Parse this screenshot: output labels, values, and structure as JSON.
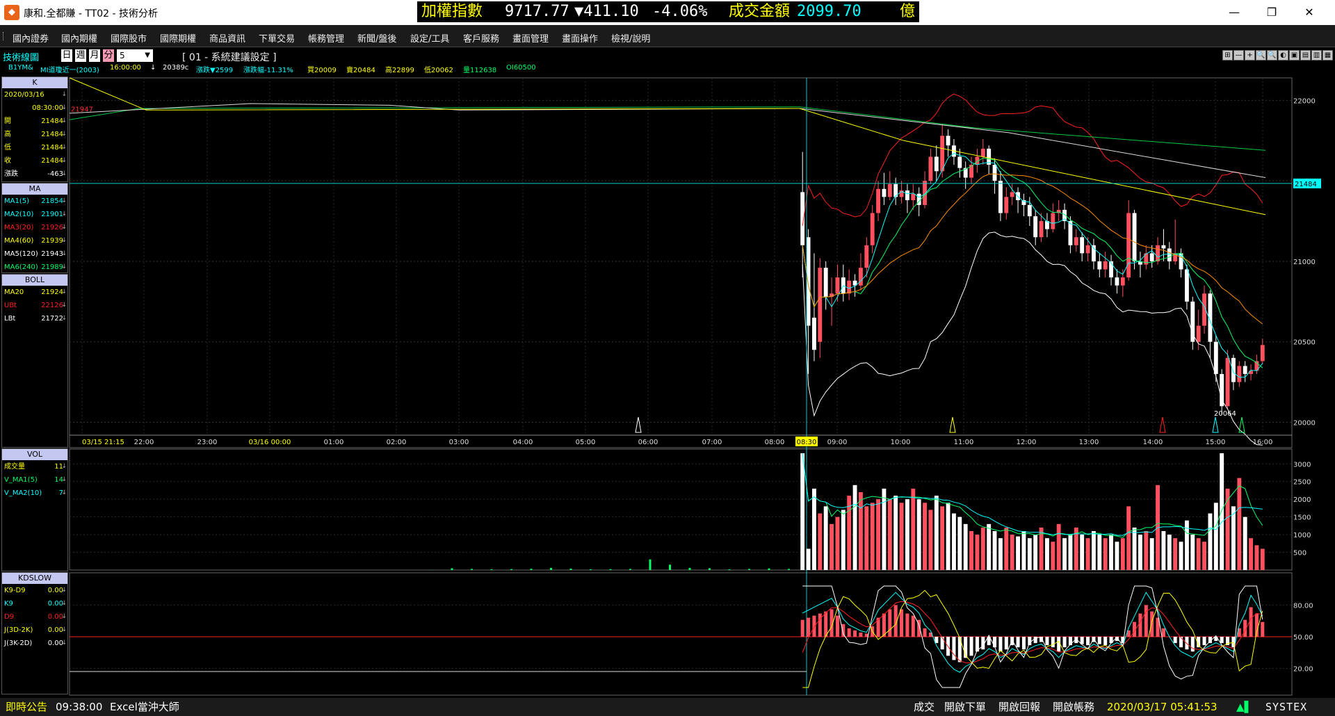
{
  "window": {
    "title": "康和.全都賺 - TT02 - 技術分析",
    "minimize_glyph": "—",
    "maximize_glyph": "❐",
    "close_glyph": "✕",
    "app_icon": "logo-icon"
  },
  "ticker": {
    "index_label": "加權指數",
    "index_value": "9717.77",
    "change": "▼411.10",
    "change_pct": "-4.06%",
    "turnover_label": "成交金額",
    "turnover_value": "2099.70",
    "unit": "億",
    "colors": {
      "label": "#ffff00",
      "value": "#ffffff",
      "down": "#ffffff",
      "accent": "#00ffff"
    }
  },
  "menu": [
    "國內證券",
    "國內期權",
    "國際股市",
    "國際期權",
    "商品資訊",
    "下單交易",
    "帳務管理",
    "新聞/盤後",
    "設定/工具",
    "客戶服務",
    "畫面管理",
    "畫面操作",
    "檢視/說明"
  ],
  "toolbar": {
    "label": "技術線圖",
    "periods": [
      "日",
      "週",
      "月",
      "分"
    ],
    "active_period": "分",
    "interval_value": "5",
    "chart_title": "[ 01 - 系統建議設定 ]",
    "buttons": [
      "⊞",
      "—",
      "+",
      "🔍",
      "🔍",
      "◐",
      "▣",
      "▤",
      "▥",
      "▦"
    ]
  },
  "info": {
    "symbol": "B1YM&",
    "name": "MI道瓊近一(2003)",
    "time": "16:00:00",
    "arrow": "↓",
    "price": "20389c",
    "change": "漲跌▼2599",
    "amplitude": "漲跌幅-11.31%",
    "bid": "買20009",
    "ask": "賣20484",
    "high": "高22899",
    "low": "低20062",
    "volume": "量112638",
    "oi": "OI60500"
  },
  "left_panels": {
    "k": {
      "header": "K",
      "rows": [
        {
          "label": "2020/03/16",
          "value": "",
          "color": "#ffff00"
        },
        {
          "label": "",
          "value": "08:30:00",
          "color": "#ffff00"
        },
        {
          "label": "開",
          "value": "21484",
          "color": "#ffff00"
        },
        {
          "label": "高",
          "value": "21484",
          "color": "#ffff00"
        },
        {
          "label": "低",
          "value": "21484",
          "color": "#ffff00"
        },
        {
          "label": "收",
          "value": "21484",
          "color": "#ffff00"
        },
        {
          "label": "漲跌",
          "value": "-463",
          "color": "#ffffff"
        }
      ]
    },
    "ma": {
      "header": "MA",
      "rows": [
        {
          "label": "MA1(5)",
          "value": "21854",
          "color": "#00ffff"
        },
        {
          "label": "MA2(10)",
          "value": "21901",
          "color": "#00ffff"
        },
        {
          "label": "MA3(20)",
          "value": "21926",
          "color": "#ff2020"
        },
        {
          "label": "MA4(60)",
          "value": "21939",
          "color": "#ffff00"
        },
        {
          "label": "MA5(120)",
          "value": "21943",
          "color": "#ffffff"
        },
        {
          "label": "MA6(240)",
          "value": "21989",
          "color": "#00ff66"
        }
      ]
    },
    "boll": {
      "header": "BOLL",
      "rows": [
        {
          "label": "MA20",
          "value": "21924",
          "color": "#ffff00"
        },
        {
          "label": "UBt",
          "value": "22126",
          "color": "#ff2020"
        },
        {
          "label": "LBt",
          "value": "21722",
          "color": "#ffffff"
        }
      ]
    },
    "vol": {
      "header": "VOL",
      "rows": [
        {
          "label": "成交量",
          "value": "11",
          "color": "#ffff00"
        },
        {
          "label": "V_MA1(5)",
          "value": "14",
          "color": "#00ff66"
        },
        {
          "label": "V_MA2(10)",
          "value": "7",
          "color": "#00ffff"
        }
      ]
    },
    "kd": {
      "header": "KDSLOW",
      "rows": [
        {
          "label": "K9-D9",
          "value": "0.00",
          "color": "#ffff00"
        },
        {
          "label": "K9",
          "value": "0.00",
          "color": "#00ffff"
        },
        {
          "label": "D9",
          "value": "0.00",
          "color": "#ff2020"
        },
        {
          "label": "J(3D-2K)",
          "value": "0.00",
          "color": "#ffff00"
        },
        {
          "label": "J(3K-2D)",
          "value": "0.00",
          "color": "#ffffff"
        }
      ]
    }
  },
  "chart_data": {
    "type": "candlestick",
    "price_axis": {
      "ticks": [
        "22000",
        "21500",
        "21000",
        "20500",
        "20000"
      ],
      "ylim": [
        19920,
        22140
      ],
      "marker": "21484",
      "low_label": "20064",
      "left_label": "21947"
    },
    "time_axis": {
      "labels": [
        "03/15 21:15",
        "22:00",
        "23:00",
        "03/16 00:00",
        "01:00",
        "02:00",
        "03:00",
        "04:00",
        "05:00",
        "06:00",
        "07:00",
        "08:00",
        "08:30",
        "09:00",
        "10:00",
        "11:00",
        "12:00",
        "13:00",
        "14:00",
        "15:00",
        "16:00"
      ],
      "highlight": "08:30"
    },
    "vol_axis": {
      "ticks": [
        "3000",
        "2500",
        "2000",
        "1500",
        "1000",
        "500"
      ],
      "ylim": [
        0,
        3300
      ]
    },
    "kd_axis": {
      "ticks": [
        "80.00",
        "50.00",
        "20.00"
      ],
      "ylim": [
        0,
        100
      ]
    },
    "candles": [
      [
        21430,
        21100,
        21680,
        20900
      ],
      [
        21150,
        20600,
        21200,
        20300
      ],
      [
        20650,
        20450,
        21050,
        20380
      ],
      [
        20500,
        20960,
        21020,
        20400
      ],
      [
        20960,
        20780,
        21000,
        20700
      ],
      [
        20780,
        20800,
        20900,
        20600
      ],
      [
        20800,
        20900,
        20980,
        20750
      ],
      [
        20900,
        20800,
        20980,
        20750
      ],
      [
        20800,
        20880,
        20950,
        20760
      ],
      [
        20880,
        20850,
        20920,
        20780
      ],
      [
        20850,
        20960,
        21050,
        20820
      ],
      [
        20960,
        21100,
        21150,
        20900
      ],
      [
        21100,
        21300,
        21350,
        21050
      ],
      [
        21300,
        21450,
        21500,
        21250
      ],
      [
        21450,
        21400,
        21550,
        21350
      ],
      [
        21400,
        21480,
        21560,
        21380
      ],
      [
        21480,
        21400,
        21520,
        21350
      ],
      [
        21400,
        21440,
        21500,
        21360
      ],
      [
        21440,
        21380,
        21480,
        21300
      ],
      [
        21380,
        21420,
        21480,
        21320
      ],
      [
        21420,
        21350,
        21460,
        21280
      ],
      [
        21350,
        21500,
        21560,
        21330
      ],
      [
        21500,
        21650,
        21700,
        21480
      ],
      [
        21650,
        21560,
        21720,
        21500
      ],
      [
        21560,
        21780,
        21850,
        21520
      ],
      [
        21780,
        21720,
        21820,
        21650
      ],
      [
        21720,
        21650,
        21760,
        21600
      ],
      [
        21650,
        21580,
        21700,
        21520
      ],
      [
        21580,
        21520,
        21620,
        21450
      ],
      [
        21520,
        21600,
        21650,
        21480
      ],
      [
        21600,
        21650,
        21700,
        21550
      ],
      [
        21650,
        21700,
        21760,
        21600
      ],
      [
        21700,
        21600,
        21720,
        21540
      ],
      [
        21600,
        21500,
        21640,
        21420
      ],
      [
        21500,
        21300,
        21560,
        21250
      ],
      [
        21300,
        21400,
        21460,
        21260
      ],
      [
        21400,
        21430,
        21480,
        21350
      ],
      [
        21430,
        21380,
        21460,
        21300
      ],
      [
        21380,
        21350,
        21420,
        21280
      ],
      [
        21350,
        21280,
        21400,
        21220
      ],
      [
        21280,
        21150,
        21320,
        21100
      ],
      [
        21150,
        21250,
        21300,
        21120
      ],
      [
        21250,
        21200,
        21300,
        21150
      ],
      [
        21200,
        21300,
        21360,
        21180
      ],
      [
        21300,
        21320,
        21380,
        21250
      ],
      [
        21320,
        21250,
        21360,
        21200
      ],
      [
        21250,
        21100,
        21280,
        21050
      ],
      [
        21100,
        21150,
        21200,
        21060
      ],
      [
        21150,
        21050,
        21180,
        21000
      ],
      [
        21050,
        21100,
        21150,
        21000
      ],
      [
        21100,
        21000,
        21140,
        20950
      ],
      [
        21000,
        20950,
        21050,
        20900
      ],
      [
        20950,
        21000,
        21060,
        20900
      ],
      [
        21000,
        20900,
        21040,
        20850
      ],
      [
        20900,
        20850,
        20950,
        20800
      ],
      [
        20850,
        20900,
        20950,
        20780
      ],
      [
        20900,
        21300,
        21380,
        20880
      ],
      [
        21300,
        21000,
        21320,
        20950
      ],
      [
        21000,
        20980,
        21060,
        20900
      ],
      [
        20980,
        21050,
        21100,
        20950
      ],
      [
        21050,
        21000,
        21100,
        20960
      ],
      [
        21000,
        21100,
        21150,
        20980
      ],
      [
        21100,
        21080,
        21200,
        21000
      ],
      [
        21080,
        21000,
        21120,
        20950
      ],
      [
        21000,
        21050,
        21260,
        20980
      ],
      [
        21050,
        20950,
        21080,
        20900
      ],
      [
        20950,
        20750,
        20980,
        20700
      ],
      [
        20750,
        20500,
        20780,
        20450
      ],
      [
        20500,
        20600,
        20700,
        20450
      ],
      [
        20600,
        20800,
        20850,
        20550
      ],
      [
        20800,
        20500,
        20820,
        20400
      ],
      [
        20500,
        20300,
        20540,
        20250
      ],
      [
        20300,
        20100,
        20330,
        20050
      ],
      [
        20100,
        20400,
        20450,
        20080
      ],
      [
        20400,
        20250,
        20420,
        20200
      ],
      [
        20250,
        20350,
        20380,
        20220
      ],
      [
        20350,
        20300,
        20380,
        20250
      ],
      [
        20300,
        20320,
        20360,
        20260
      ],
      [
        20320,
        20380,
        20420,
        20300
      ],
      [
        20380,
        20480,
        20520,
        20360
      ]
    ],
    "volume_pre": [
      3,
      50,
      30,
      20,
      25,
      35,
      60,
      40,
      20,
      25,
      30,
      300,
      150,
      60,
      50,
      20,
      30,
      45,
      30,
      20
    ],
    "volume": [
      3300,
      600,
      2300,
      1600,
      1800,
      1300,
      1500,
      1700,
      2100,
      2400,
      2200,
      1800,
      1900,
      2000,
      2300,
      2000,
      2100,
      1900,
      2000,
      2300,
      2000,
      1900,
      1700,
      2100,
      1800,
      1900,
      1600,
      1500,
      1300,
      1100,
      1000,
      1200,
      1300,
      1100,
      900,
      1200,
      1000,
      950,
      1100,
      900,
      1000,
      1200,
      900,
      800,
      1300,
      900,
      1000,
      1200,
      1000,
      900,
      1100,
      1000,
      900,
      1000,
      800,
      900,
      1800,
      1200,
      1000,
      1100,
      900,
      2400,
      1100,
      1000,
      900,
      800,
      1400,
      1000,
      900,
      800,
      1600,
      1900,
      3300,
      2300,
      1800,
      2600,
      1500,
      900,
      700,
      600
    ],
    "kd_hist": [
      16,
      18,
      20,
      22,
      24,
      26,
      20,
      12,
      8,
      6,
      4,
      3,
      10,
      18,
      22,
      26,
      30,
      26,
      22,
      20,
      16,
      8,
      4,
      -6,
      -12,
      -18,
      -22,
      -24,
      -20,
      -18,
      -14,
      -12,
      -8,
      -10,
      -14,
      -12,
      -8,
      -10,
      -12,
      -8,
      -6,
      -5,
      -8,
      -10,
      -14,
      -10,
      -8,
      -6,
      -7,
      -8,
      -5,
      -7,
      -8,
      -6,
      -4,
      -6,
      6,
      14,
      22,
      30,
      24,
      18,
      8,
      0,
      -6,
      -10,
      -12,
      -14,
      -10,
      -8,
      -6,
      -4,
      -6,
      -8,
      -10,
      8,
      16,
      28,
      22,
      14
    ],
    "ma_lines": {
      "ma240": [
        21990,
        21900
      ],
      "boll_upper_top": 22140
    }
  },
  "statusbar": {
    "announce_label": "即時公告",
    "announce_time": "09:38:00",
    "announce_text": "Excel當沖大師",
    "btn_trades": "成交",
    "btn_order": "開啟下單",
    "btn_report": "開啟回報",
    "btn_account": "開啟帳務",
    "datetime": "2020/03/17 05:41:53",
    "brand": "SYSTEX",
    "colors": {
      "label": "#ffff00",
      "text": "#ffffff",
      "datetime": "#ffff00"
    }
  }
}
